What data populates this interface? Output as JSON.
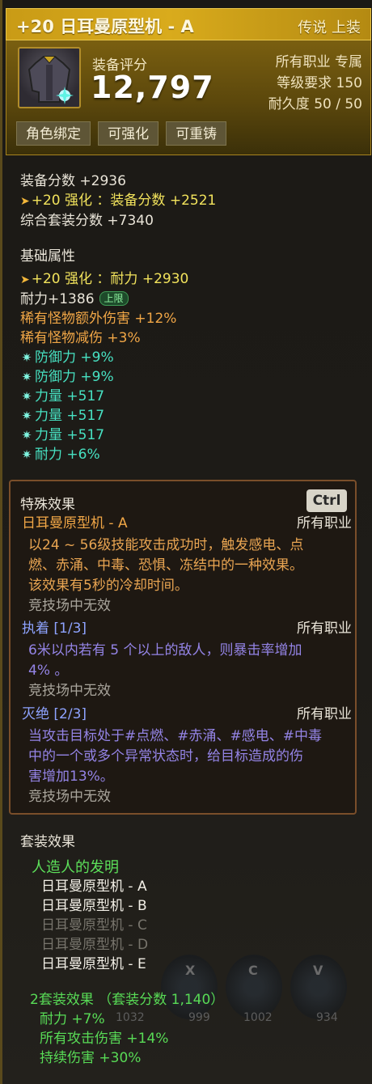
{
  "header": {
    "title": "+20 日耳曼原型机 - A",
    "grade": "传说 上装",
    "score_label": "装备评分",
    "score_value": "12,797",
    "meta": [
      "所有职业 专属",
      "等级要求 150",
      "耐久度 50 / 50"
    ],
    "tags": [
      "角色绑定",
      "可强化",
      "可重铸"
    ]
  },
  "score_section": {
    "base": "装备分数 +2936",
    "enhance": "+20 强化 ：装备分数 +2521",
    "set_total": "综合套装分数 +7340"
  },
  "basic": {
    "title": "基础属性",
    "enhance": "+20 强化 ：耐力 +2930",
    "stamina": "耐力+1386",
    "stamina_badge": "上限",
    "rare_dmg": "稀有怪物额外伤害 +12%",
    "rare_reduce": "稀有怪物减伤 +3%",
    "bonus_stats": [
      "防御力 +9%",
      "防御力 +9%",
      "力量 +517",
      "力量 +517",
      "力量 +517",
      "耐力 +6%"
    ]
  },
  "special": {
    "title": "特殊效果",
    "key_hint": "Ctrl",
    "effects": [
      {
        "name": "日耳曼原型机 - A",
        "job": "所有职业",
        "desc": [
          "以24 ~ 56级技能攻击成功时，触发感电、点",
          "燃、赤涌、中毒、恐惧、冻结中的一种效果。",
          "该效果有5秒的冷却时间。"
        ],
        "note": "竞技场中无效"
      },
      {
        "name": "执着 [1/3]",
        "job": "所有职业",
        "desc": [
          "6米以内若有 5 个以上的敌人，则暴击率增加",
          "4% 。"
        ],
        "note": "竞技场中无效"
      },
      {
        "name": "灭绝 [2/3]",
        "job": "所有职业",
        "desc": [
          "当攻击目标处于#点燃、#赤涌、#感电、#中毒",
          "中的一个或多个异常状态时，给目标造成的伤",
          "害增加13%。"
        ],
        "note": "竞技场中无效"
      }
    ]
  },
  "set": {
    "title": "套装效果",
    "name": "人造人的发明",
    "pieces": [
      {
        "label": "日耳曼原型机 - A",
        "active": true
      },
      {
        "label": "日耳曼原型机 - B",
        "active": true
      },
      {
        "label": "日耳曼原型机 - C",
        "active": false
      },
      {
        "label": "日耳曼原型机 - D",
        "active": false
      },
      {
        "label": "日耳曼原型机 - E",
        "active": true
      }
    ],
    "bonus_title": "2套装效果 （套装分数 1,140）",
    "bonus_lines": [
      "耐力 +7%",
      "所有攻击伤害 +14%",
      "持续伤害 +30%"
    ]
  },
  "background_skillbar": {
    "keys": [
      "X",
      "C",
      "V"
    ],
    "counts": [
      "1032",
      "999",
      "1002",
      "934"
    ]
  },
  "colors": {
    "title_gold": "#d9ab1c",
    "enhance_yellow": "#f2e35c",
    "rare_orange": "#f0a646",
    "bonus_teal": "#47e1c2",
    "set_green": "#5ce05a",
    "effect_purple": "#9484e6"
  }
}
